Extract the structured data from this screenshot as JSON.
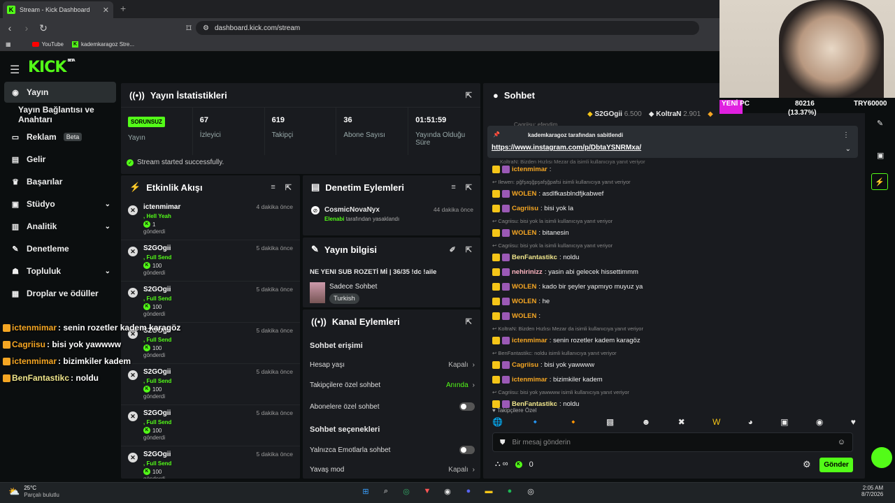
{
  "browser": {
    "tab_title": "Stream - Kick Dashboard",
    "url": "dashboard.kick.com/stream",
    "bookmarks": [
      "YouTube",
      "kademkaragoz Stre..."
    ]
  },
  "app": {
    "logo": "KICK",
    "logo_badge": "BETA"
  },
  "sidebar": {
    "items": [
      {
        "label": "Yayın",
        "icon": "broadcast-icon"
      },
      {
        "label": "Yayın Bağlantısı ve Anahtarı"
      },
      {
        "label": "Reklam",
        "badge": "Beta",
        "icon": "ad-icon"
      },
      {
        "label": "Gelir",
        "icon": "revenue-icon"
      },
      {
        "label": "Başarılar",
        "icon": "trophy-icon"
      },
      {
        "label": "Stüdyo",
        "icon": "studio-icon"
      },
      {
        "label": "Analitik",
        "icon": "analytics-icon"
      },
      {
        "label": "Denetleme",
        "icon": "wrench-icon"
      },
      {
        "label": "Topluluk",
        "icon": "community-icon"
      },
      {
        "label": "Droplar ve ödüller",
        "icon": "drops-icon"
      }
    ]
  },
  "stats": {
    "title": "Yayın İstatistikleri",
    "status_pill": "SORUNSUZ",
    "status_label": "Yayın",
    "items": [
      {
        "value": "67",
        "label": "İzleyici"
      },
      {
        "value": "619",
        "label": "Takipçi"
      },
      {
        "value": "36",
        "label": "Abone Sayısı"
      },
      {
        "value": "01:51:59",
        "label": "Yayında Olduğu Süre"
      }
    ],
    "success": "Stream started successfully."
  },
  "activity": {
    "title": "Etkinlik Akışı",
    "events": [
      {
        "name": "ictenmimar",
        "time": "4 dakika önce",
        "msg": ", Hell Yeah",
        "amount": "1",
        "sent": "gönderdi"
      },
      {
        "name": "S2GOgii",
        "time": "5 dakika önce",
        "msg": ", Full Send",
        "amount": "100",
        "sent": "gönderdi"
      },
      {
        "name": "S2GOgii",
        "time": "5 dakika önce",
        "msg": ", Full Send",
        "amount": "100",
        "sent": "gönderdi"
      },
      {
        "name": "S2GOgii",
        "time": "5 dakika önce",
        "msg": ", Full Send",
        "amount": "100",
        "sent": "gönderdi"
      },
      {
        "name": "S2GOgii",
        "time": "5 dakika önce",
        "msg": ", Full Send",
        "amount": "100",
        "sent": "gönderdi"
      },
      {
        "name": "S2GOgii",
        "time": "5 dakika önce",
        "msg": ", Full Send",
        "amount": "100",
        "sent": "gönderdi"
      },
      {
        "name": "S2GOgii",
        "time": "5 dakika önce",
        "msg": ", Full Send",
        "amount": "100",
        "sent": "gönderdi"
      }
    ]
  },
  "moderation": {
    "title": "Denetim Eylemleri",
    "user": "CosmicNovaNyx",
    "time": "44 dakika önce",
    "by": "Elenabi",
    "by_suffix": "tarafından yasaklandı"
  },
  "stream_info": {
    "title": "Yayın bilgisi",
    "stream_title": "NE YENI SUB ROZETİ Mİ | 36/35 !dc !aile",
    "category": "Sadece Sohbet",
    "language": "Turkish"
  },
  "channel_actions": {
    "title": "Kanal Eylemleri",
    "section1": "Sohbet erişimi",
    "rows1": [
      {
        "label": "Hesap yaşı",
        "value": "Kapalı"
      },
      {
        "label": "Takipçilere özel sohbet",
        "value": "Anında"
      },
      {
        "label": "Abonelere özel sohbet",
        "value": ""
      }
    ],
    "section2": "Sohbet seçenekleri",
    "rows2": [
      {
        "label": "Yalnızca Emotlarla sohbet",
        "value": ""
      },
      {
        "label": "Yavaş mod",
        "value": "Kapalı"
      }
    ]
  },
  "chat": {
    "title": "Sohbet",
    "top_gifters": [
      {
        "name": "S2GOgii",
        "amount": "6.500"
      },
      {
        "name": "KoltraN",
        "amount": "2.901"
      }
    ],
    "pinned_by": "kademkaragoz tarafından sabitlendi",
    "pinned_link": "https://www.instagram.com/p/DbtaYSNRMxa/",
    "pinned_hidden_top": "Cagriisu: efendim",
    "pinned_hidden_reply": "KoltraN: Bizden Hızlısı Mezar da isimli kullanıcıya yanıt veriyor",
    "messages": [
      {
        "user": "ictenmimar",
        "text": ":",
        "color": "#f5a623"
      },
      {
        "reply": "Ilewen: pğfşaşğpşafşğpafsi isimli kullanıcıya yanıt veriyor"
      },
      {
        "user": "WOLEN",
        "text": ": asdlfkasblndfjkabwef",
        "color": "#f5a623"
      },
      {
        "user": "Cagriisu",
        "text": ": bisi yok la",
        "color": "#f5a623"
      },
      {
        "reply": "Cagriisu: bisi yok la isimli kullanıcıya yanıt veriyor"
      },
      {
        "user": "WOLEN",
        "text": ": bitanesin",
        "color": "#f5a623"
      },
      {
        "reply": "Cagriisu: bisi yok la isimli kullanıcıya yanıt veriyor"
      },
      {
        "user": "BenFantastikc",
        "text": ": noldu",
        "color": "#f0e68c"
      },
      {
        "user": "nehirinizz",
        "text": ": yasin abi gelecek hissettimmm",
        "color": "#ffb6c1"
      },
      {
        "user": "WOLEN",
        "text": ": kado bir şeyler yapmıyo muyuz ya",
        "color": "#f5a623"
      },
      {
        "user": "WOLEN",
        "text": ": he",
        "color": "#f5a623"
      },
      {
        "user": "WOLEN",
        "text": ":",
        "color": "#f5a623"
      },
      {
        "reply": "KoltraN: Bizden Hızlısı Mezar da isimli kullanıcıya yanıt veriyor"
      },
      {
        "user": "ictenmimar",
        "text": ": senin rozetler kadem karagöz",
        "color": "#f5a623"
      },
      {
        "reply": "BenFantastikc: noldu isimli kullanıcıya yanıt veriyor"
      },
      {
        "user": "Cagriisu",
        "text": ": bisi yok yawwww",
        "color": "#f5a623"
      },
      {
        "user": "ictenmimar",
        "text": ": bizimkiler kadem",
        "color": "#f5a623"
      },
      {
        "reply": "Cagriisu: bisi yok yawwww isimli kullanıcıya yanıt veriyor"
      },
      {
        "user": "BenFantastikc",
        "text": ": noldu",
        "color": "#f0e68c"
      }
    ],
    "followers_only": "Takipçilere Özel",
    "input_placeholder": "Bir mesaj gönderin",
    "count": "0",
    "send": "Gönder"
  },
  "overlay": {
    "lines": [
      {
        "user": "ictenmimar",
        "text": " : senin rozetler kadem karagöz",
        "color": "#f5a623"
      },
      {
        "user": "Cagriisu",
        "text": " : bisi yok yawwww",
        "color": "#f5a623"
      },
      {
        "user": "ictenmimar",
        "text": " : bizimkiler kadem",
        "color": "#f5a623"
      },
      {
        "user": "BenFantastikc",
        "text": " : noldu",
        "color": "#f0e68c"
      }
    ],
    "cam_label": "YENİ PC",
    "cam_value1": "80216",
    "cam_value2": "(13.37%)",
    "cam_value3": "TRY60000"
  },
  "taskbar": {
    "weather_temp": "25°C",
    "weather_desc": "Parçalı bulutlu",
    "time": "2:05 AM",
    "date": "8/7/2026"
  },
  "colors": {
    "accent": "#53fc18",
    "panel": "#191b1f",
    "background": "#0b0e0f"
  }
}
